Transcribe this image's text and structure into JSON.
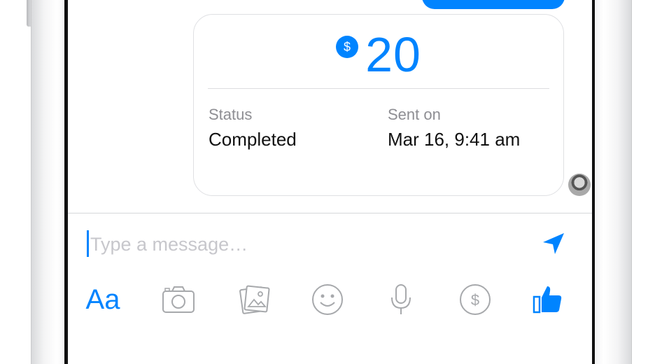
{
  "payment": {
    "currency_symbol": "$",
    "amount": "20",
    "status_label": "Status",
    "status_value": "Completed",
    "sent_on_label": "Sent on",
    "sent_on_value": "Mar 16, 9:41 am"
  },
  "composer": {
    "placeholder": "Type a message…"
  },
  "toolbar": {
    "text_format_label": "Aa",
    "icons": [
      "camera-icon",
      "photo-icon",
      "emoji-icon",
      "microphone-icon",
      "payment-icon",
      "like-icon"
    ]
  },
  "colors": {
    "accent": "#0084ff",
    "icon_gray": "#a7a9ac",
    "divider": "#dcdde0"
  }
}
